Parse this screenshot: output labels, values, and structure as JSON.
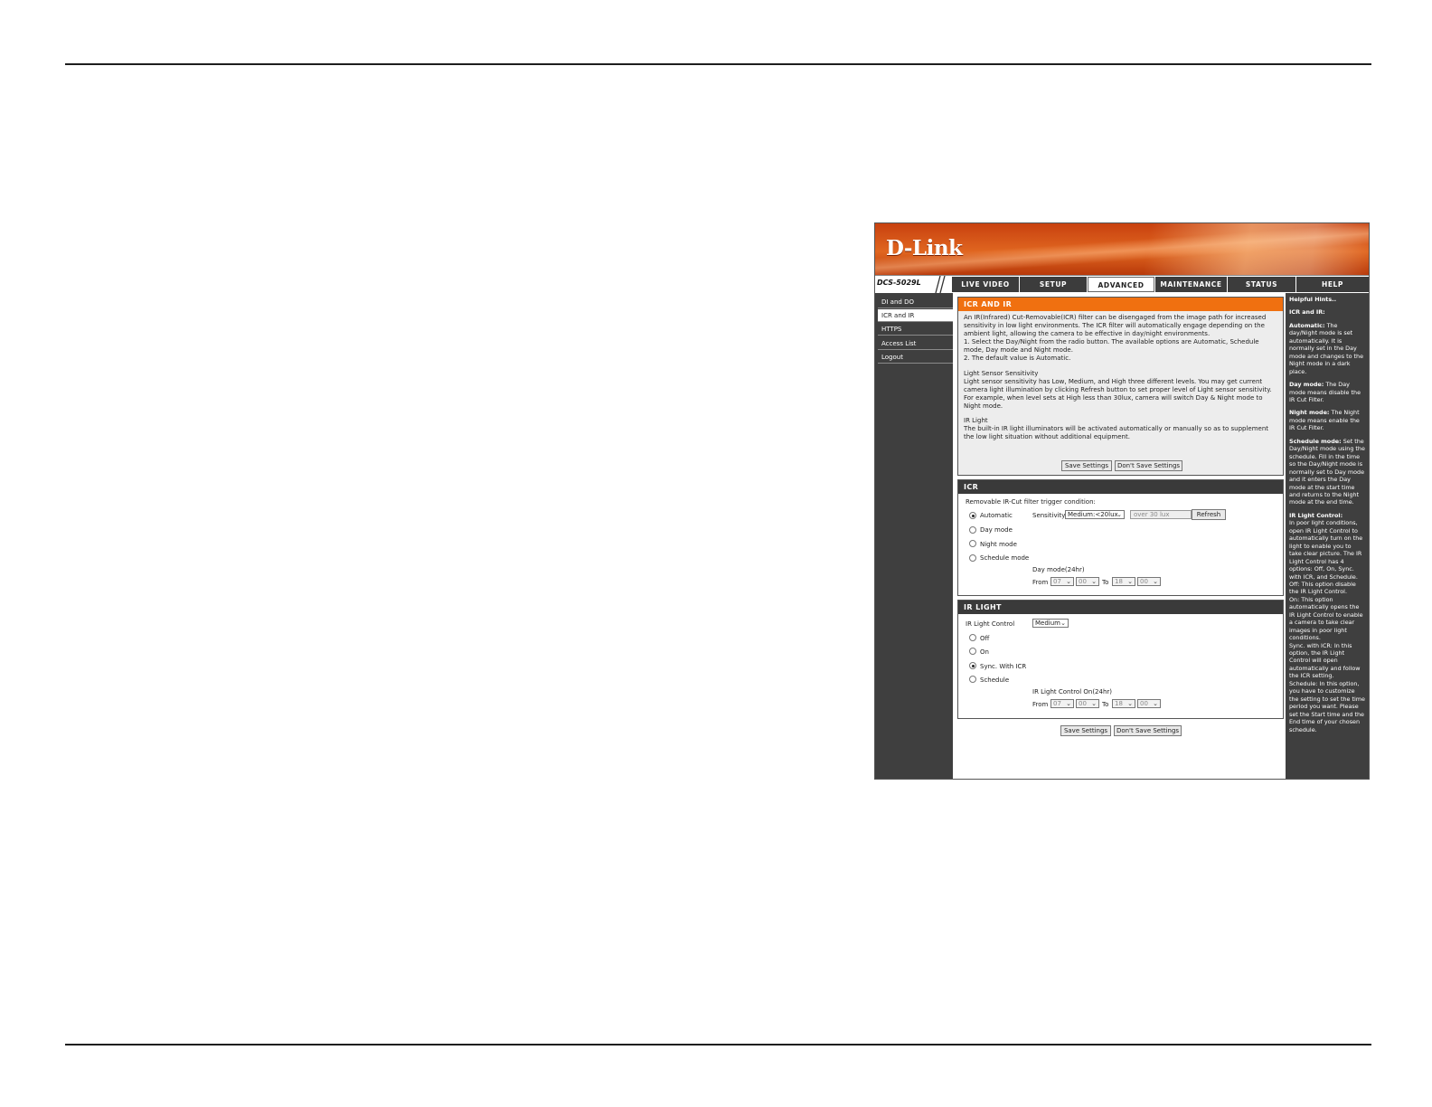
{
  "brand": {
    "logo": "D-Link",
    "model": "DCS-5029L"
  },
  "nav": {
    "tabs": [
      {
        "label": "LIVE VIDEO"
      },
      {
        "label": "SETUP"
      },
      {
        "label": "ADVANCED"
      },
      {
        "label": "MAINTENANCE"
      },
      {
        "label": "STATUS"
      },
      {
        "label": "HELP"
      }
    ],
    "active_tab": "ADVANCED"
  },
  "sidebar": {
    "items": [
      {
        "label": "DI and DO"
      },
      {
        "label": "ICR and IR"
      },
      {
        "label": "HTTPS"
      },
      {
        "label": "Access List"
      },
      {
        "label": "Logout"
      }
    ],
    "active_item": "ICR and IR"
  },
  "intro": {
    "title": "ICR AND IR",
    "p1": "An IR(Infrared) Cut-Removable(ICR) filter can be disengaged from the image path for increased sensitivity in low light environments. The ICR filter will automatically engage depending on the ambient light, allowing the camera to be effective in day/night environments.",
    "p2": "1. Select the Day/Night from the radio button. The available options are Automatic, Schedule mode, Day mode and Night mode.",
    "p3": "2. The default value is Automatic.",
    "p4_title": "Light Sensor Sensitivity",
    "p4": "Light sensor sensitivity has Low, Medium, and High three different levels. You may get current camera light illumination by clicking Refresh button to set proper level of Light sensor sensitivity. For example, when level sets at High less than 30lux, camera will switch Day & Night mode to Night mode.",
    "p5_title": "IR Light",
    "p5": "The built-in IR light illuminators will be activated automatically or manually so as to supplement the low light situation without additional equipment.",
    "save_label": "Save Settings",
    "dont_save_label": "Don't Save Settings"
  },
  "icr": {
    "title": "ICR",
    "trigger_label": "Removable IR-Cut filter trigger condition:",
    "options": [
      {
        "label": "Automatic",
        "checked": true
      },
      {
        "label": "Day mode",
        "checked": false
      },
      {
        "label": "Night mode",
        "checked": false
      },
      {
        "label": "Schedule mode",
        "checked": false
      }
    ],
    "sensitivity_label": "Sensitivity",
    "sensitivity_value": "Medium:<20lux",
    "lux_reading": "over 30 lux",
    "refresh_label": "Refresh",
    "day_mode_label": "Day mode(24hr)",
    "from_label": "From",
    "to_label": "To",
    "from_hour": "07",
    "from_min": "00",
    "to_hour": "18",
    "to_min": "00"
  },
  "ir_light": {
    "title": "IR LIGHT",
    "control_label": "IR Light Control",
    "control_value": "Medium",
    "options": [
      {
        "label": "Off",
        "checked": false
      },
      {
        "label": "On",
        "checked": false
      },
      {
        "label": "Sync. With ICR",
        "checked": true
      },
      {
        "label": "Schedule",
        "checked": false
      }
    ],
    "schedule_label": "IR Light Control On(24hr)",
    "from_label": "From",
    "to_label": "To",
    "from_hour": "07",
    "from_min": "00",
    "to_hour": "18",
    "to_min": "00"
  },
  "footer": {
    "save_label": "Save Settings",
    "dont_save_label": "Don't Save Settings"
  },
  "help": {
    "title": "Helpful Hints..",
    "subtitle": "ICR and IR:",
    "automatic_title": "Automatic:",
    "automatic_text": "The day/Night mode is set automatically. It is normally set in the Day mode and changes to the Night mode in a dark place.",
    "day_title": "Day mode:",
    "day_text": "The Day mode means disable the IR Cut Filter.",
    "night_title": "Night mode:",
    "night_text": "The Night mode means enable the IR Cut Filter.",
    "schedule_title": "Schedule mode:",
    "schedule_text": "Set the Day/Night mode using the schedule. Fill in the time so the Day/Night mode is normally set to Day mode and it enters the Day mode at the start time and returns to the Night mode at the end time.",
    "irlc_title": "IR Light Control:",
    "irlc_text": "In poor light conditions, open IR Light Control to automatically turn on the light to enable you to take clear picture. The IR Light Control has 4 options: Off, On, Sync. with ICR, and Schedule.",
    "off_text": "Off: This option disable the IR Light Control.",
    "on_text": "On: This option automatically opens the IR Light Control to enable a camera to take clear images in poor light conditions.",
    "sync_text": "Sync. with ICR: In this option, the IR Light Control will open automatically and follow the ICR setting.",
    "sched_text": "Schedule: In this option, you have to customize the setting to set the time period you want. Please set the Start time and the End time of your chosen schedule."
  },
  "colors": {
    "accent": "#f07010",
    "dark": "#3f3f3f",
    "banner": "#d9581a"
  }
}
